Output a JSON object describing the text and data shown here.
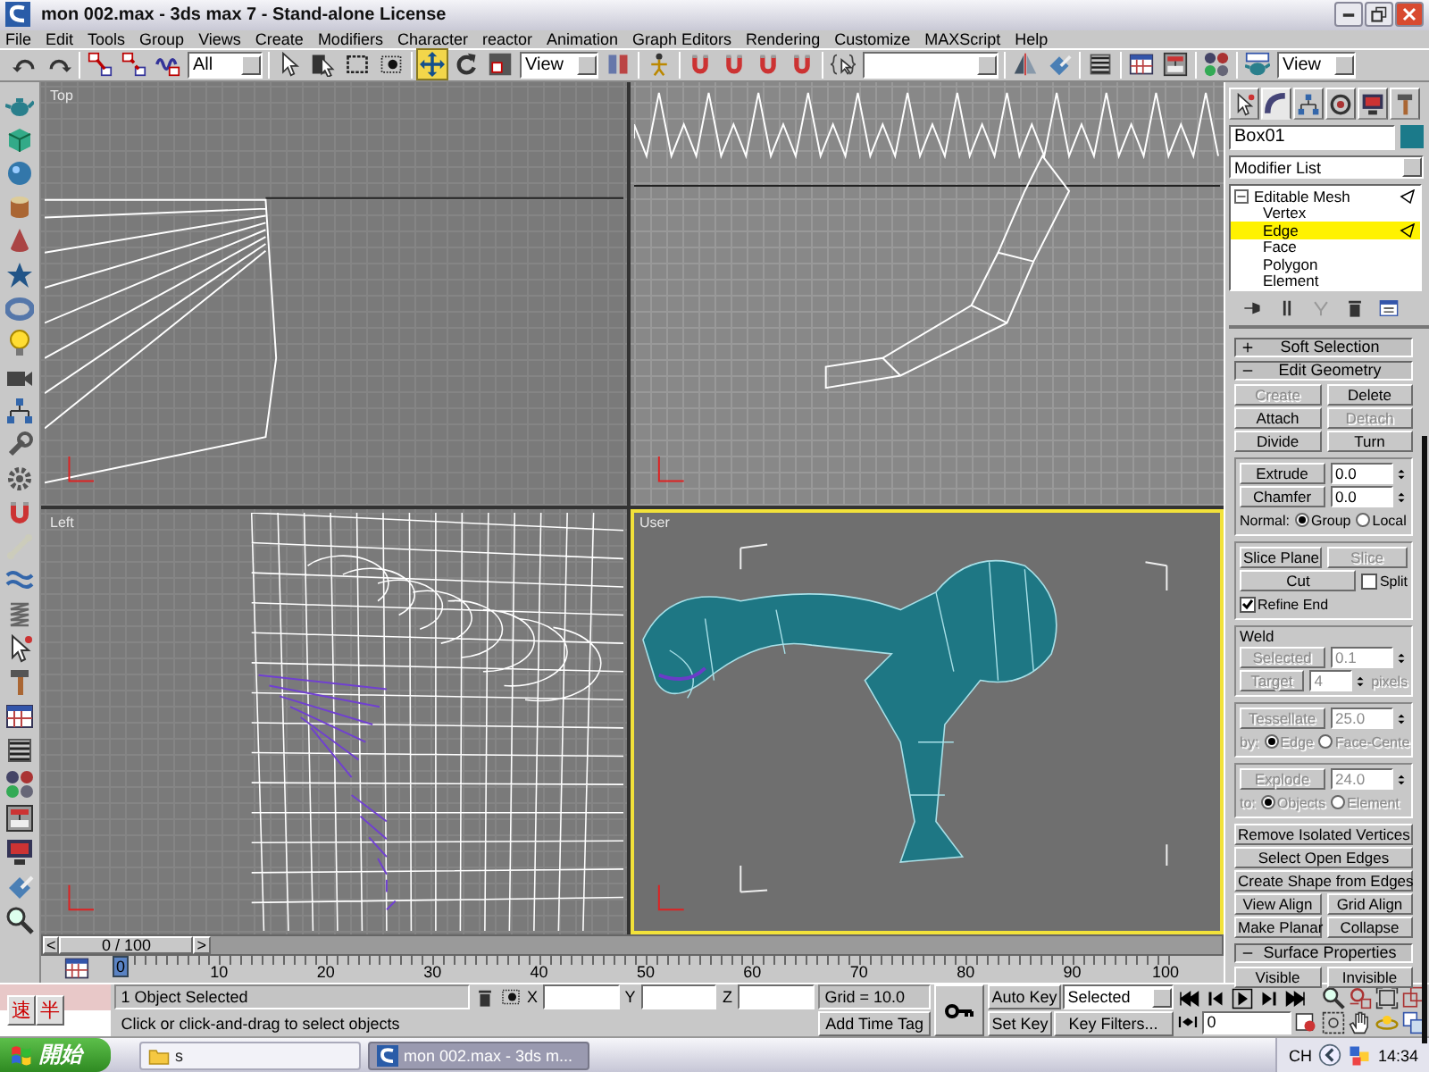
{
  "window": {
    "title": "mon 002.max - 3ds max 7  - Stand-alone License"
  },
  "menu": [
    "File",
    "Edit",
    "Tools",
    "Group",
    "Views",
    "Create",
    "Modifiers",
    "Character",
    "reactor",
    "Animation",
    "Graph Editors",
    "Rendering",
    "Customize",
    "MAXScript",
    "Help"
  ],
  "toolbar": {
    "selection_filter": "All",
    "reference_coordinate": "View",
    "render_type": "View",
    "tools": [
      {
        "selected": false
      },
      {
        "selected": false
      },
      {
        "selected": false
      },
      {
        "selected": false
      },
      {
        "selected": false
      },
      {
        "selected": false
      },
      {
        "selected": false
      },
      {
        "selected": false
      },
      {
        "selected": false
      },
      {
        "selected": true
      },
      {
        "selected": false
      },
      {
        "selected": false
      },
      {
        "selected": false
      },
      {
        "selected": false
      },
      {
        "selected": false
      },
      {
        "selected": false
      },
      {
        "selected": false
      },
      {
        "selected": false
      },
      {
        "selected": false
      },
      {
        "selected": false
      },
      {
        "selected": false
      },
      {
        "selected": false
      },
      {
        "selected": false
      },
      {
        "selected": false
      },
      {
        "selected": false
      },
      {
        "selected": false
      }
    ]
  },
  "viewports": [
    {
      "label": "Top",
      "active": false
    },
    {
      "active": false
    },
    {
      "label": "Left",
      "active": false
    },
    {
      "label": "User",
      "active": true
    }
  ],
  "command_panel": {
    "tabs": [
      {
        "selected": false
      },
      {
        "selected": true
      },
      {
        "selected": false
      },
      {
        "selected": false
      },
      {
        "selected": false
      },
      {
        "selected": false
      }
    ],
    "object_name": "Box01",
    "modifier_list": "Modifier List",
    "stack": [
      {
        "label": "Editable Mesh",
        "expanded": true,
        "selected": false,
        "children": [
          {
            "label": "Vertex",
            "selected": false
          },
          {
            "label": "Edge",
            "selected": true
          },
          {
            "label": "Face",
            "selected": false
          },
          {
            "label": "Polygon",
            "selected": false
          },
          {
            "label": "Element",
            "selected": false
          }
        ]
      }
    ],
    "rollouts": [
      {
        "title": "Soft Selection",
        "expanded": false
      },
      {
        "title": "Edit Geometry",
        "expanded": true,
        "blocks": [
          {
            "rows": [
              {
                "items": [
                  {
                    "kind": "button",
                    "label": "Create",
                    "disabled": true
                  },
                  {
                    "kind": "button",
                    "label": "Delete",
                    "disabled": false
                  }
                ]
              },
              {
                "items": [
                  {
                    "kind": "button",
                    "label": "Attach",
                    "disabled": false
                  },
                  {
                    "kind": "button",
                    "label": "Detach",
                    "disabled": true
                  }
                ]
              },
              {
                "items": [
                  {
                    "kind": "button",
                    "label": "Divide",
                    "disabled": false
                  },
                  {
                    "kind": "button",
                    "label": "Turn",
                    "disabled": false
                  }
                ]
              }
            ]
          },
          {
            "framed": true,
            "rows": [
              {
                "items": [
                  {
                    "kind": "button",
                    "label": "Extrude",
                    "disabled": false
                  },
                  {
                    "kind": "spinner",
                    "value": "0.0",
                    "disabled": false
                  }
                ]
              },
              {
                "items": [
                  {
                    "kind": "button",
                    "label": "Chamfer",
                    "disabled": false
                  },
                  {
                    "kind": "spinner",
                    "value": "0.0",
                    "disabled": false
                  }
                ]
              },
              {
                "items": [
                  {
                    "kind": "text",
                    "label": "Normal:",
                    "disabled": false
                  },
                  {
                    "kind": "radio",
                    "label": "Group",
                    "selected": true,
                    "disabled": false
                  },
                  {
                    "kind": "radio",
                    "label": "Local",
                    "selected": false,
                    "disabled": false
                  }
                ]
              }
            ]
          },
          {
            "framed": true,
            "rows": [
              {
                "items": [
                  {
                    "kind": "button",
                    "label": "Slice Plane",
                    "disabled": false
                  },
                  {
                    "kind": "button",
                    "label": "Slice",
                    "disabled": true
                  }
                ]
              },
              {
                "items": [
                  {
                    "kind": "button",
                    "label": "Cut",
                    "disabled": false
                  },
                  {
                    "kind": "checkbox",
                    "label": "Split",
                    "checked": false,
                    "disabled": false
                  }
                ]
              },
              {
                "items": [
                  {
                    "kind": "checkbox",
                    "label": "Refine End",
                    "checked": true,
                    "disabled": false
                  }
                ]
              }
            ]
          },
          {
            "framed": true,
            "title": "Weld",
            "rows": [
              {
                "items": [
                  {
                    "kind": "button",
                    "label": "Selected",
                    "disabled": true
                  },
                  {
                    "kind": "spinner",
                    "value": "0.1",
                    "disabled": true
                  }
                ]
              },
              {
                "items": [
                  {
                    "kind": "button",
                    "label": "Target",
                    "disabled": true
                  },
                  {
                    "kind": "spinner",
                    "value": "4",
                    "disabled": true
                  },
                  {
                    "kind": "text",
                    "label": "pixels",
                    "disabled": true
                  }
                ]
              }
            ]
          },
          {
            "framed": true,
            "rows": [
              {
                "items": [
                  {
                    "kind": "button",
                    "label": "Tessellate",
                    "disabled": true
                  },
                  {
                    "kind": "spinner",
                    "value": "25.0",
                    "disabled": true
                  }
                ]
              },
              {
                "items": [
                  {
                    "kind": "text",
                    "label": "by:",
                    "disabled": true
                  },
                  {
                    "kind": "radio",
                    "label": "Edge",
                    "selected": true,
                    "disabled": true
                  },
                  {
                    "kind": "radio",
                    "label": "Face-Cente",
                    "selected": false,
                    "disabled": true
                  }
                ]
              }
            ]
          },
          {
            "framed": true,
            "rows": [
              {
                "items": [
                  {
                    "kind": "button",
                    "label": "Explode",
                    "disabled": true
                  },
                  {
                    "kind": "spinner",
                    "value": "24.0",
                    "disabled": true
                  }
                ]
              },
              {
                "items": [
                  {
                    "kind": "text",
                    "label": "to:",
                    "disabled": true
                  },
                  {
                    "kind": "radio",
                    "label": "Objects",
                    "selected": true,
                    "disabled": true
                  },
                  {
                    "kind": "radio",
                    "label": "Element",
                    "selected": false,
                    "disabled": true
                  }
                ]
              }
            ]
          },
          {
            "rows": [
              {
                "items": [
                  {
                    "kind": "button",
                    "label": "Remove Isolated Vertices",
                    "disabled": false
                  }
                ]
              },
              {
                "items": [
                  {
                    "kind": "button",
                    "label": "Select Open Edges",
                    "disabled": false
                  }
                ]
              },
              {
                "items": [
                  {
                    "kind": "button",
                    "label": "Create Shape from Edges",
                    "disabled": false
                  }
                ]
              },
              {
                "items": [
                  {
                    "kind": "button",
                    "label": "View Align",
                    "disabled": false
                  },
                  {
                    "kind": "button",
                    "label": "Grid Align",
                    "disabled": false
                  }
                ]
              },
              {
                "items": [
                  {
                    "kind": "button",
                    "label": "Make Planar",
                    "disabled": false
                  },
                  {
                    "kind": "button",
                    "label": "Collapse",
                    "disabled": false
                  }
                ]
              }
            ]
          }
        ]
      },
      {
        "title": "Surface Properties",
        "expanded": true,
        "blocks": [
          {
            "rows": [
              {
                "items": [
                  {
                    "kind": "button",
                    "label": "Visible",
                    "disabled": false
                  },
                  {
                    "kind": "button",
                    "label": "Invisible",
                    "disabled": false
                  }
                ]
              }
            ]
          }
        ]
      }
    ]
  },
  "time_slider": {
    "prev": "<",
    "position": "0 / 100",
    "next": ">"
  },
  "track_bar": {
    "ticks": [
      "0",
      "10",
      "20",
      "30",
      "40",
      "50",
      "60",
      "70",
      "80",
      "90",
      "100"
    ]
  },
  "status": {
    "ime": [
      "速",
      "半"
    ],
    "selection": "1 Object Selected",
    "prompt": "Click or click-and-drag to select objects",
    "coords": [
      {
        "axis": "X"
      },
      {
        "axis": "Y"
      },
      {
        "axis": "Z"
      }
    ],
    "grid": "Grid = 10.0",
    "time_tag": "Add Time Tag",
    "auto_key": {
      "label": "Auto Key",
      "on": false
    },
    "key_mode": "Selected",
    "set_key": "Set Key",
    "key_filters": "Key Filters...",
    "frame": "0"
  },
  "taskbar": {
    "start": "開始",
    "tasks": [
      {
        "label": "s",
        "selected": false
      },
      {
        "label": "mon 002.max - 3ds m...",
        "selected": true
      }
    ],
    "tray": [
      "CH"
    ],
    "clock": "14:34"
  }
}
